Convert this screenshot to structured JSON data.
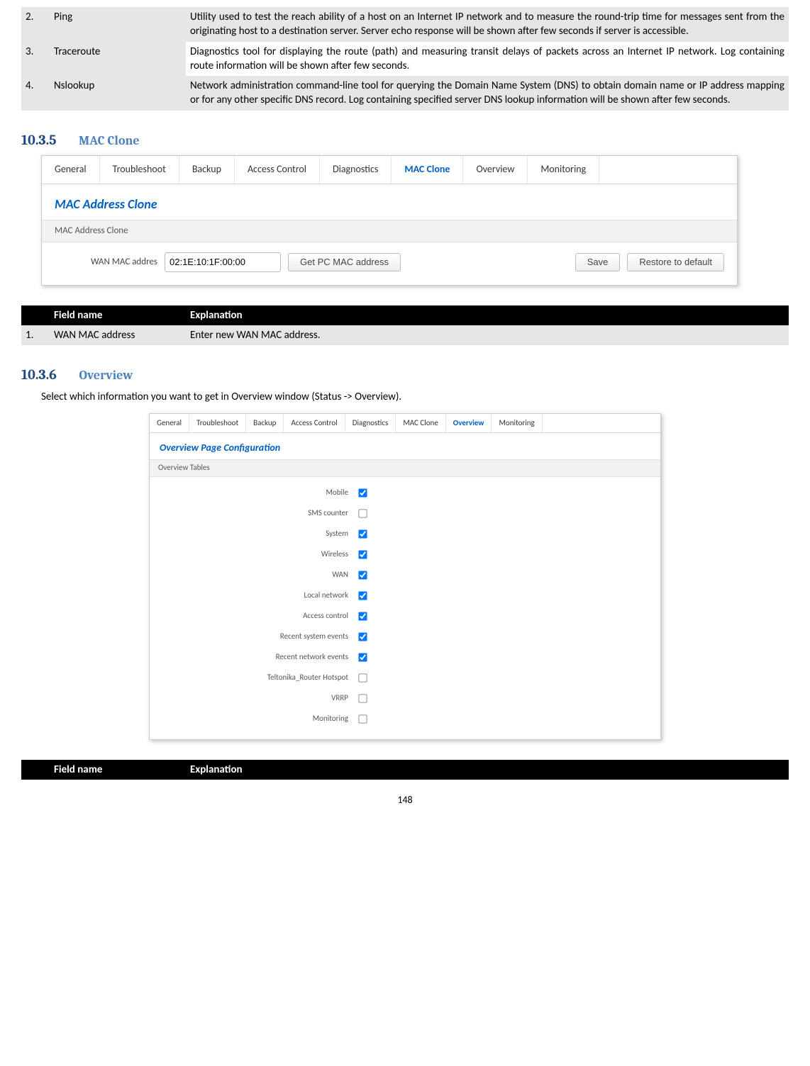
{
  "top_table_rows": [
    {
      "num": "2.",
      "name": "Ping",
      "desc": "Utility used to test the reach ability of a host on an Internet IP network and to measure the round-trip time for messages sent from the originating host to a destination server. Server echo response will be shown after few seconds if server is accessible.",
      "row": "gray"
    },
    {
      "num": "3.",
      "name": "Traceroute",
      "desc": "Diagnostics tool for displaying the route (path) and measuring transit delays of packets across an Internet IP network. Log containing route information will be shown after few seconds.",
      "row": "white"
    },
    {
      "num": "4.",
      "name": "Nslookup",
      "desc": "Network administration command-line tool for querying the Domain Name System (DNS) to obtain domain name or IP address mapping or for any other specific DNS record. Log containing specified server DNS lookup information will be shown after few seconds.",
      "row": "gray"
    }
  ],
  "section1": {
    "num": "10.3.5",
    "title": "MAC Clone"
  },
  "mac_tabs": [
    {
      "label": "General"
    },
    {
      "label": "Troubleshoot"
    },
    {
      "label": "Backup"
    },
    {
      "label": "Access Control"
    },
    {
      "label": "Diagnostics"
    },
    {
      "label": "MAC Clone",
      "active": true
    },
    {
      "label": "Overview"
    },
    {
      "label": "Monitoring"
    }
  ],
  "mac_panel": {
    "title": "MAC Address Clone",
    "subhead": "MAC Address Clone",
    "field_label": "WAN MAC addres",
    "field_value": "02:1E:10:1F:00:00",
    "btn_getpc": "Get PC MAC address",
    "btn_save": "Save",
    "btn_restore": "Restore to default"
  },
  "mac_field_table": {
    "head_num": "",
    "head_name": "Field name",
    "head_desc": "Explanation",
    "rows": [
      {
        "num": "1.",
        "name": "WAN MAC address",
        "desc": "Enter new WAN MAC address."
      }
    ]
  },
  "section2": {
    "num": "10.3.6",
    "title": "Overview"
  },
  "overview_intro": "Select which information you want to get in Overview window (Status -> Overview).",
  "ov_tabs": [
    {
      "label": "General"
    },
    {
      "label": "Troubleshoot"
    },
    {
      "label": "Backup"
    },
    {
      "label": "Access Control"
    },
    {
      "label": "Diagnostics"
    },
    {
      "label": "MAC Clone"
    },
    {
      "label": "Overview",
      "active": true
    },
    {
      "label": "Monitoring"
    }
  ],
  "ov_panel": {
    "title": "Overview Page Configuration",
    "subhead": "Overview Tables",
    "rows": [
      {
        "label": "Mobile",
        "checked": true
      },
      {
        "label": "SMS counter",
        "checked": false
      },
      {
        "label": "System",
        "checked": true
      },
      {
        "label": "Wireless",
        "checked": true
      },
      {
        "label": "WAN",
        "checked": true
      },
      {
        "label": "Local network",
        "checked": true
      },
      {
        "label": "Access control",
        "checked": true
      },
      {
        "label": "Recent system events",
        "checked": true
      },
      {
        "label": "Recent network events",
        "checked": true
      },
      {
        "label": "Teltonika_Router Hotspot",
        "checked": false
      },
      {
        "label": "VRRP",
        "checked": false
      },
      {
        "label": "Monitoring",
        "checked": false
      }
    ]
  },
  "bottom_field_table": {
    "head_name": "Field name",
    "head_desc": "Explanation"
  },
  "page_number": "148"
}
